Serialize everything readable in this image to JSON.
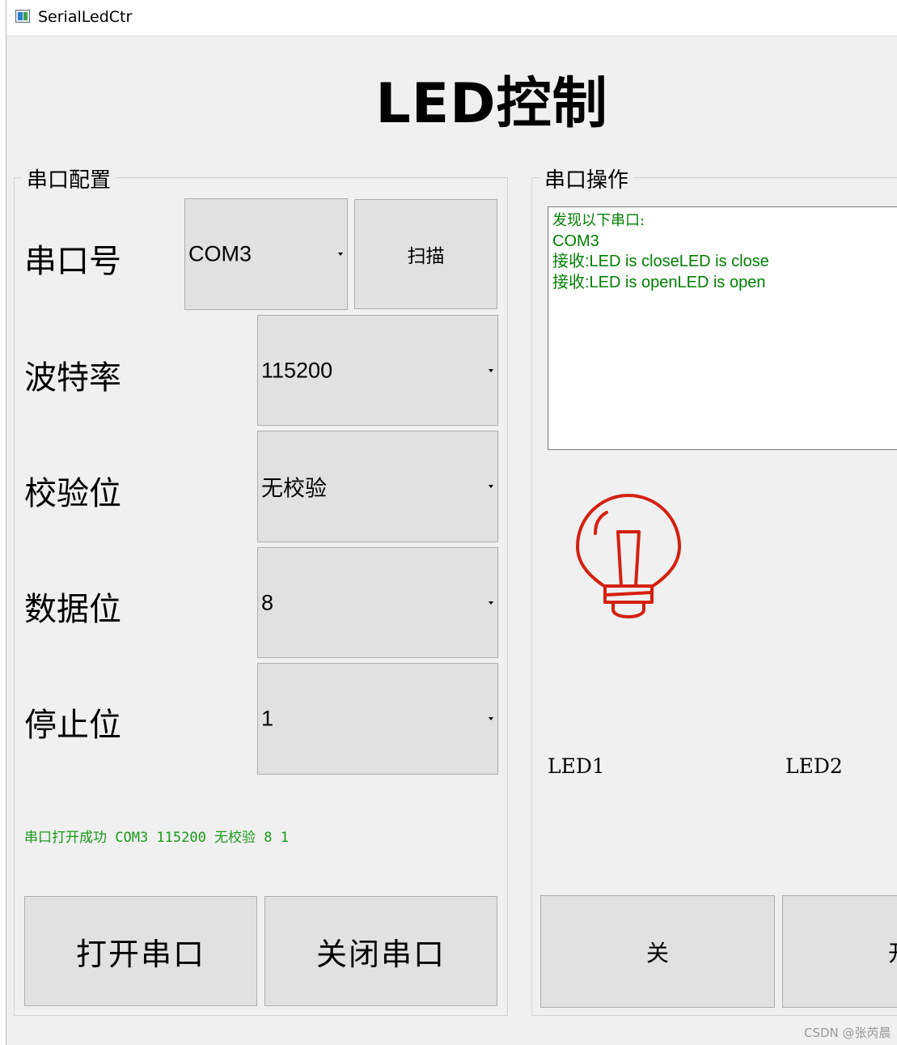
{
  "window": {
    "title": "SerialLedCtr"
  },
  "header": {
    "title": "LED控制"
  },
  "serial_config": {
    "group_title": "串口配置",
    "port": {
      "label": "串口号",
      "value": "COM3",
      "scan_label": "扫描"
    },
    "baud": {
      "label": "波特率",
      "value": "115200"
    },
    "parity": {
      "label": "校验位",
      "value": "无校验"
    },
    "data_bits": {
      "label": "数据位",
      "value": "8"
    },
    "stop_bits": {
      "label": "停止位",
      "value": "1"
    },
    "status": "串口打开成功 COM3 115200 无校验 8 1",
    "open_label": "打开串口",
    "close_label": "关闭串口"
  },
  "serial_ops": {
    "group_title": "串口操作",
    "log": [
      "发现以下串口:",
      "COM3",
      "接收:LED is closeLED is close",
      "接收:LED is openLED is open"
    ],
    "bulb_icon": "lightbulb-icon",
    "bulb_color": "#d42010",
    "led1_label": "LED1",
    "led2_label": "LED2",
    "off_label": "关",
    "on_label": "开"
  },
  "watermark": "CSDN @张芮晨",
  "colors": {
    "status_green": "#1a9a1a",
    "log_green": "#008000"
  }
}
